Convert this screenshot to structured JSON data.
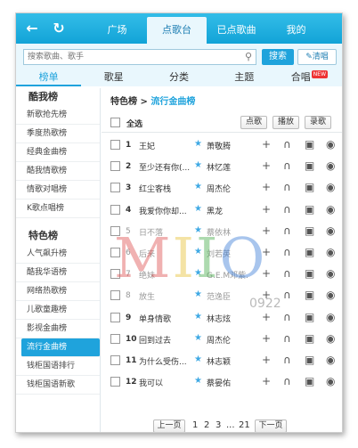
{
  "header": {
    "tabs": [
      {
        "label": "广场"
      },
      {
        "label": "点歌台"
      },
      {
        "label": "已点歌曲"
      },
      {
        "label": "我的"
      }
    ]
  },
  "search": {
    "placeholder": "搜索歌曲、歌手",
    "search_label": "搜索",
    "clear_label": "清唱"
  },
  "categories": [
    {
      "label": "榜单"
    },
    {
      "label": "歌星"
    },
    {
      "label": "分类"
    },
    {
      "label": "主题"
    },
    {
      "label": "合唱",
      "badge": "NEW"
    }
  ],
  "sidebar": {
    "section1": "酷我榜",
    "items1": [
      {
        "label": "新歌抢先榜"
      },
      {
        "label": "季度热歌榜"
      },
      {
        "label": "经典金曲榜"
      },
      {
        "label": "酷我情歌榜"
      },
      {
        "label": "情歌对唱榜"
      },
      {
        "label": "K歌点唱榜"
      }
    ],
    "section2": "特色榜",
    "items2": [
      {
        "label": "人气飙升榜"
      },
      {
        "label": "酷我华语榜"
      },
      {
        "label": "网络热歌榜"
      },
      {
        "label": "儿歌童趣榜"
      },
      {
        "label": "影视金曲榜"
      },
      {
        "label": "流行金曲榜"
      },
      {
        "label": "钱柜国语排行"
      },
      {
        "label": "钱柜国语新歌"
      }
    ]
  },
  "breadcrumb": {
    "parent": "特色榜",
    "sep": " > ",
    "current": "流行金曲榜"
  },
  "toolbar": {
    "select_all": "全选",
    "request": "点歌",
    "play": "播放",
    "record": "录歌"
  },
  "songs": [
    {
      "num": "1",
      "title": "王妃",
      "singer": "萧敬腾",
      "gray": false
    },
    {
      "num": "2",
      "title": "至少还有你(...",
      "singer": "林忆莲",
      "gray": false
    },
    {
      "num": "3",
      "title": "红尘客栈",
      "singer": "周杰伦",
      "gray": false
    },
    {
      "num": "4",
      "title": "我爱你你却...",
      "singer": "黑龙",
      "gray": false
    },
    {
      "num": "5",
      "title": "日不落",
      "singer": "蔡依林",
      "gray": true
    },
    {
      "num": "6",
      "title": "后来",
      "singer": "刘若英",
      "gray": true
    },
    {
      "num": "7",
      "title": "绝妹",
      "singer": "G.E.M邓紫...",
      "gray": true
    },
    {
      "num": "8",
      "title": "放生",
      "singer": "范逸臣",
      "gray": true
    },
    {
      "num": "9",
      "title": "单身情歌",
      "singer": "林志炫",
      "gray": false
    },
    {
      "num": "10",
      "title": "回到过去",
      "singer": "周杰伦",
      "gray": false
    },
    {
      "num": "11",
      "title": "为什么受伤...",
      "singer": "林志颖",
      "gray": false
    },
    {
      "num": "12",
      "title": "我可以",
      "singer": "蔡晏佑",
      "gray": false
    }
  ],
  "pager": {
    "prev": "上一页",
    "pages": [
      "1",
      "2",
      "3",
      "...",
      "21"
    ],
    "next": "下一页"
  },
  "watermark": {
    "letters": "MIIO",
    "number": "0922"
  },
  "colors": {
    "accent": "#1fa3dc",
    "topbar": "#12a3d7",
    "badge": "#e33333"
  }
}
